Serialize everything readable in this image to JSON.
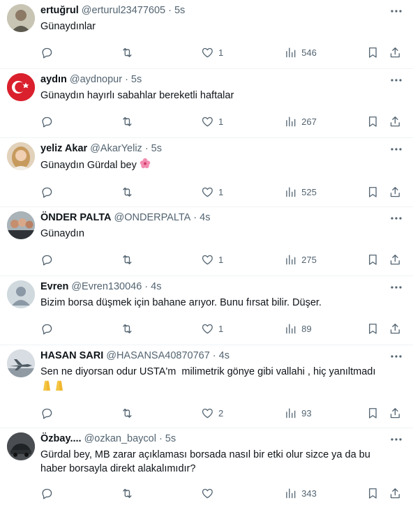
{
  "tweets": [
    {
      "name": "ertuğrul",
      "handle": "@erturul23477605",
      "sep": "·",
      "time": "5s",
      "text": "Günaydınlar",
      "replies": "",
      "retweets": "",
      "likes": "1",
      "views": "546",
      "avatar_icon": "avatar-photo-man"
    },
    {
      "name": "aydın",
      "handle": "@aydnopur",
      "sep": "·",
      "time": "5s",
      "text": "Günaydın hayırlı sabahlar bereketli haftalar",
      "replies": "",
      "retweets": "",
      "likes": "1",
      "views": "267",
      "avatar_icon": "turkish-flag-avatar"
    },
    {
      "name": "yeliz Akar",
      "handle": "@AkarYeliz",
      "sep": "·",
      "time": "5s",
      "text": "Günaydın Gürdal bey",
      "emoji": "hibiscus-flower-emoji",
      "replies": "",
      "retweets": "",
      "likes": "1",
      "views": "525",
      "avatar_icon": "avatar-photo-woman"
    },
    {
      "name": "ÖNDER PALTA",
      "handle": "@ONDERPALTA",
      "sep": "·",
      "time": "4s",
      "text": "Günaydın",
      "replies": "",
      "retweets": "",
      "likes": "1",
      "views": "275",
      "avatar_icon": "avatar-photo-group"
    },
    {
      "name": "Evren",
      "handle": "@Evren130046",
      "sep": "·",
      "time": "4s",
      "text": "Bizim borsa düşmek için bahane arıyor. Bunu fırsat bilir. Düşer.",
      "replies": "",
      "retweets": "",
      "likes": "1",
      "views": "89",
      "avatar_icon": "default-user-avatar"
    },
    {
      "name": "HASAN SARI",
      "handle": "@HASANSA40870767",
      "sep": "·",
      "time": "4s",
      "text": "Sen ne diyorsan odur USTA'm  milimetrik gönye gibi vallahi , hiç yanıltmadı",
      "emoji": "folded-hands-emoji",
      "replies": "",
      "retweets": "",
      "likes": "2",
      "views": "93",
      "avatar_icon": "avatar-photo-jet"
    },
    {
      "name": "Özbay....",
      "handle": "@ozkan_baycol",
      "sep": "·",
      "time": "5s",
      "text": "Gürdal bey, MB zarar açıklaması borsada nasıl bir etki olur sizce ya da bu haber borsayla direkt alakalımıdır?",
      "replies": "",
      "retweets": "",
      "likes": "",
      "views": "343",
      "avatar_icon": "avatar-photo-car"
    }
  ],
  "colors": {
    "text": "#0f1419",
    "secondary": "#536471",
    "divider": "#eff3f4"
  }
}
